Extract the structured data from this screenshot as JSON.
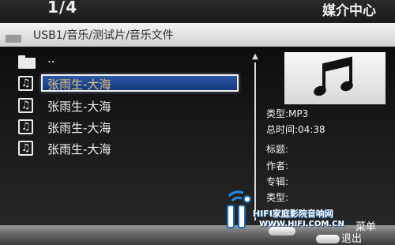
{
  "header": {
    "page_counter": "1/4",
    "app_title": "媒介中心"
  },
  "path": {
    "text": "USB1/音乐/测试片/音乐文件"
  },
  "file_list": {
    "parent_label": "..",
    "items": [
      {
        "label": "张雨生-大海",
        "selected": true
      },
      {
        "label": "张雨生-大海",
        "selected": false
      },
      {
        "label": "张雨生-大海",
        "selected": false
      },
      {
        "label": "张雨生-大海",
        "selected": false
      }
    ]
  },
  "info": {
    "type": "类型:MP3",
    "duration": "总时间:04:38",
    "title": "标题:",
    "artist": "作者:",
    "album": "专辑:",
    "genre": "类型:"
  },
  "bottom": {
    "menu_label": "菜单",
    "exit_label": "退出"
  },
  "watermark": {
    "title": "HIFI家庭影院音响网",
    "url": "WWW.HIFI.COM.CN"
  },
  "icons": {
    "folder": "folder-icon",
    "music_file": "music-note-icon",
    "album_art": "music-notes-icon",
    "scroll_up": "arrow-up-icon"
  },
  "colors": {
    "selection": "#2b5aa8",
    "path_bar": "#e6e6e6",
    "watermark_blue": "#1a6fc0"
  }
}
